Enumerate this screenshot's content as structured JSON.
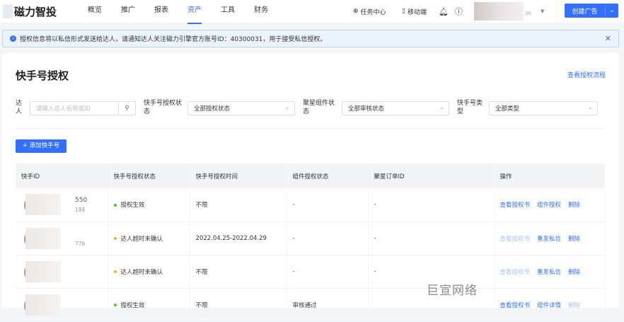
{
  "nav": {
    "brand": "磁力智投",
    "menu": [
      "概览",
      "推广",
      "报表",
      "资产",
      "工具",
      "财务"
    ],
    "active": 3,
    "task_center": "任务中心",
    "mobile": "移动端",
    "user_suffix": "36",
    "create_ad": "创建广告"
  },
  "alert": {
    "text": "授权信息将以私信形式发送给达人，请通知达人关注磁力引擎官方账号ID：40300031，用于接受私信授权。"
  },
  "page": {
    "title": "快手号授权",
    "flow_link": "查看授权流程"
  },
  "filters": {
    "talent_label": "达人",
    "talent_placeholder": "请输入达人名称或ID",
    "auth_label": "快手号授权状态",
    "auth_value": "全部授权状态",
    "component_label": "聚星组件状态",
    "component_value": "全部审核状态",
    "type_label": "快手号类型",
    "type_value": "全部类型"
  },
  "add_button": "+ 添加快手号",
  "table": {
    "headers": [
      "快手ID",
      "快手号授权状态",
      "快手号授权时间",
      "组件授权状态",
      "聚星订单ID",
      "操作"
    ],
    "rows": [
      {
        "id_tail": "550",
        "sub_tail": "184",
        "status": "授权生效",
        "status_color": "#52c41a",
        "time": "不限",
        "component": "-",
        "order": "-",
        "actions": [
          {
            "label": "查看授权书",
            "disabled": false
          },
          {
            "label": "组件授权",
            "disabled": false
          },
          {
            "label": "删除",
            "disabled": false
          }
        ]
      },
      {
        "id_tail": "",
        "sub_tail": "776",
        "status": "达人超时未确认",
        "status_color": "#faad14",
        "time": "2022.04.25-2022.04.29",
        "component": "-",
        "order": "-",
        "actions": [
          {
            "label": "查看授权书",
            "disabled": true
          },
          {
            "label": "重发私信",
            "disabled": false
          },
          {
            "label": "删除",
            "disabled": false
          }
        ]
      },
      {
        "id_tail": "",
        "sub_tail": "",
        "status": "达人超时未确认",
        "status_color": "#faad14",
        "time": "不限",
        "component": "-",
        "order": "-",
        "actions": [
          {
            "label": "查看授权书",
            "disabled": true
          },
          {
            "label": "重发私信",
            "disabled": false
          },
          {
            "label": "删除",
            "disabled": false
          }
        ]
      },
      {
        "id_tail": "",
        "sub_tail": "",
        "status": "授权生效",
        "status_color": "#52c41a",
        "time": "不限",
        "component": "审核通过",
        "order": "",
        "actions": [
          {
            "label": "查看授权书",
            "disabled": false
          },
          {
            "label": "组件详情",
            "disabled": false
          },
          {
            "label": "删除",
            "disabled": true
          }
        ]
      }
    ]
  },
  "watermark": "巨宣网络"
}
